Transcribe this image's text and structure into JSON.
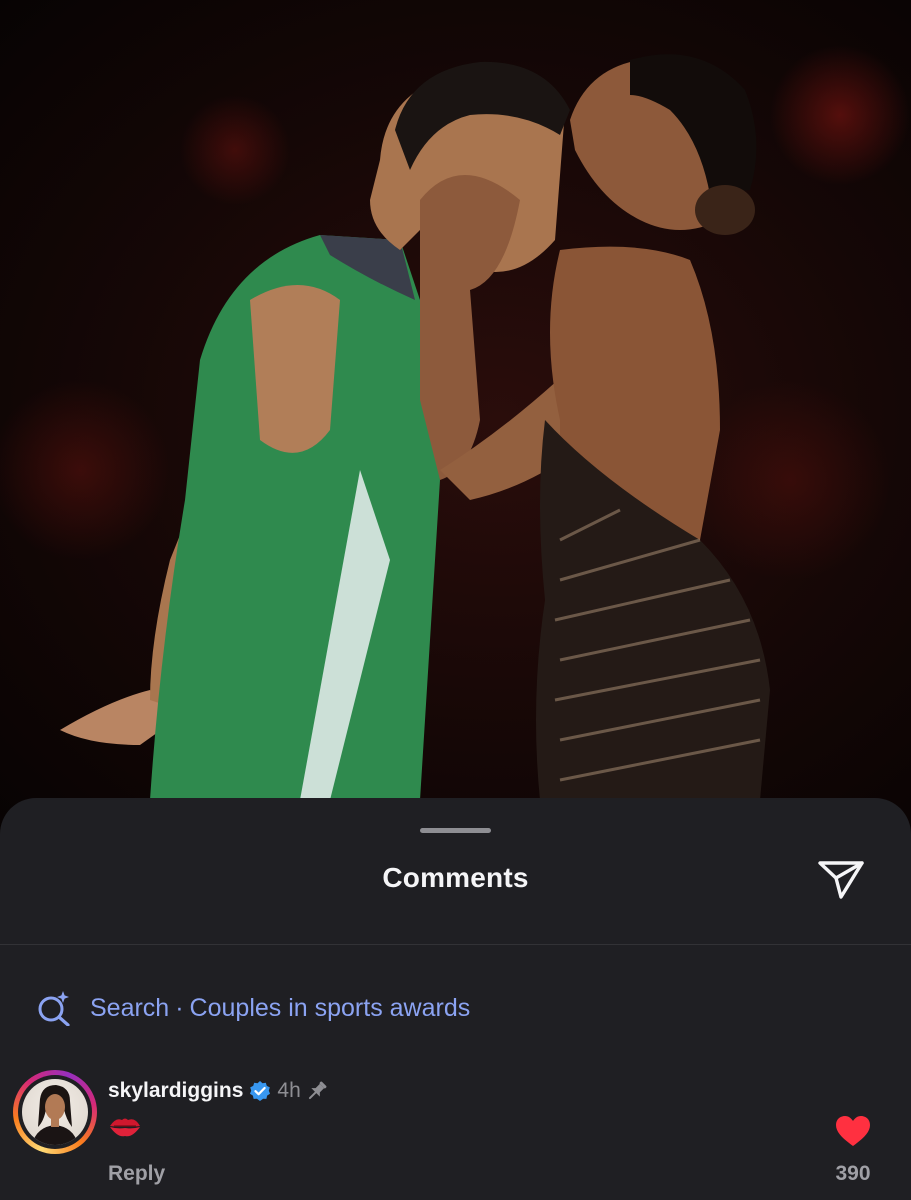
{
  "post_image": {
    "description_icon": "photo-icon"
  },
  "sheet": {
    "title": "Comments",
    "share_icon": "send-icon"
  },
  "search": {
    "icon": "ai-search-icon",
    "prefix": "Search",
    "separator": "·",
    "query": "Couples in sports awards"
  },
  "comment": {
    "username": "skylardiggins",
    "verified": true,
    "time": "4h",
    "pinned": true,
    "body_icon": "kiss-mark-icon",
    "reply_label": "Reply",
    "like_count": "390",
    "liked": true
  },
  "colors": {
    "sheet_bg": "#1f1f23",
    "search_text": "#8ba3f2",
    "verified_badge": "#3897f0",
    "heart": "#ff3040"
  }
}
